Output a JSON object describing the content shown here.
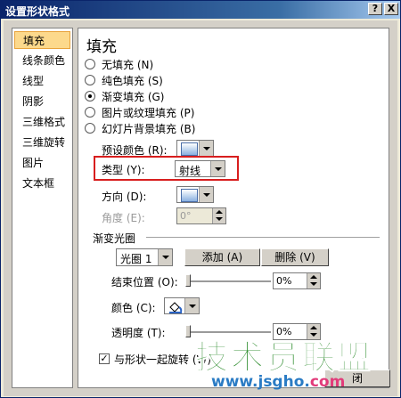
{
  "window": {
    "title": "设置形状格式",
    "help": "?",
    "close": "X"
  },
  "nav": {
    "items": [
      {
        "label": "填充",
        "selected": true
      },
      {
        "label": "线条颜色"
      },
      {
        "label": "线型"
      },
      {
        "label": "阴影"
      },
      {
        "label": "三维格式"
      },
      {
        "label": "三维旋转"
      },
      {
        "label": "图片"
      },
      {
        "label": "文本框"
      }
    ]
  },
  "fill": {
    "heading": "填充",
    "options": [
      {
        "label": "无填充 (N)",
        "selected": false
      },
      {
        "label": "纯色填充 (S)",
        "selected": false
      },
      {
        "label": "渐变填充 (G)",
        "selected": true
      },
      {
        "label": "图片或纹理填充 (P)",
        "selected": false
      },
      {
        "label": "幻灯片背景填充 (B)",
        "selected": false
      }
    ],
    "preset_label": "预设颜色 (R):",
    "type_label": "类型 (Y):",
    "type_value": "射线",
    "direction_label": "方向 (D):",
    "angle_label": "角度 (E):",
    "angle_value": "0°",
    "stops_heading": "渐变光圈",
    "stop_select": "光圈 1",
    "add_button": "添加 (A)",
    "delete_button": "删除 (V)",
    "end_pos_label": "结束位置 (O):",
    "end_pos_value": "0%",
    "end_pos_level": 0,
    "color_label": "颜色 (C):",
    "transparency_label": "透明度 (T):",
    "transparency_value": "0%",
    "transparency_level": 0,
    "rotate_label": "与形状一起旋转 (W)",
    "rotate_checked": true
  },
  "footer": {
    "close_button_partial": "闭"
  },
  "watermark": {
    "text": "技术员联盟",
    "url_prefix": "www.jsgho.",
    "url_suffix": "com"
  },
  "colors": {
    "title_bar": "#0a246a",
    "selection": "#fcd98c",
    "highlight_box": "#d81e1e",
    "watermark_green": "#2f8d2f",
    "watermark_blue": "#2a7bc4"
  }
}
